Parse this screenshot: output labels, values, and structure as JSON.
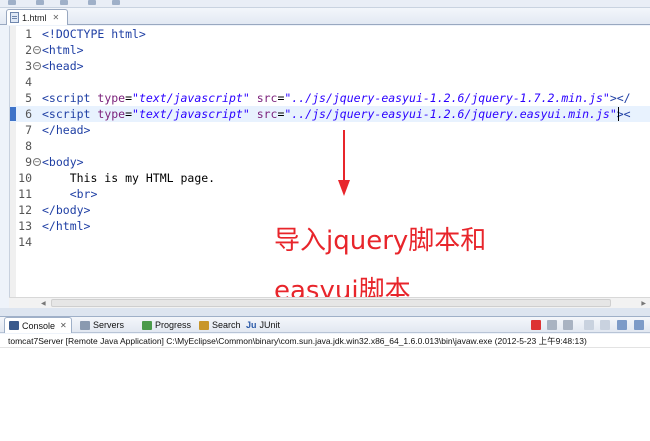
{
  "editor_tab": {
    "label": "1.html",
    "close": "✕"
  },
  "lines": [
    {
      "num": "1",
      "fold": false,
      "tokens": [
        {
          "t": "<!DOCTYPE html>",
          "c": "tag"
        }
      ]
    },
    {
      "num": "2",
      "fold": true,
      "tokens": [
        {
          "t": "<html>",
          "c": "tag"
        }
      ]
    },
    {
      "num": "3",
      "fold": true,
      "tokens": [
        {
          "t": "<head>",
          "c": "tag"
        }
      ]
    },
    {
      "num": "4",
      "fold": false,
      "tokens": []
    },
    {
      "num": "5",
      "fold": false,
      "tokens": [
        {
          "t": "<script",
          "c": "tag"
        },
        {
          "t": " ",
          "c": "txt"
        },
        {
          "t": "type",
          "c": "attr"
        },
        {
          "t": "=",
          "c": "txt"
        },
        {
          "t": "\"text/javascript\"",
          "c": "str"
        },
        {
          "t": " ",
          "c": "txt"
        },
        {
          "t": "src",
          "c": "attr"
        },
        {
          "t": "=",
          "c": "txt"
        },
        {
          "t": "\"../js/jquery-easyui-1.2.6/jquery-1.7.2.min.js\"",
          "c": "str"
        },
        {
          "t": "></",
          "c": "tag"
        }
      ]
    },
    {
      "num": "6",
      "fold": false,
      "highlight": true,
      "tokens": [
        {
          "t": "<script",
          "c": "tag"
        },
        {
          "t": " ",
          "c": "txt"
        },
        {
          "t": "type",
          "c": "attr"
        },
        {
          "t": "=",
          "c": "txt"
        },
        {
          "t": "\"text/javascript\"",
          "c": "str"
        },
        {
          "t": " ",
          "c": "txt"
        },
        {
          "t": "src",
          "c": "attr"
        },
        {
          "t": "=",
          "c": "txt"
        },
        {
          "t": "\"../js/jquery-easyui-1.2.6/jquery.easyui.min.js\"",
          "c": "str"
        },
        {
          "t": "><",
          "c": "tag"
        }
      ]
    },
    {
      "num": "7",
      "fold": false,
      "tokens": [
        {
          "t": "</head>",
          "c": "tag"
        }
      ]
    },
    {
      "num": "8",
      "fold": false,
      "tokens": []
    },
    {
      "num": "9",
      "fold": true,
      "tokens": [
        {
          "t": "<body>",
          "c": "tag"
        }
      ]
    },
    {
      "num": "10",
      "fold": false,
      "tokens": [
        {
          "t": "    This is my HTML page.",
          "c": "txt"
        }
      ]
    },
    {
      "num": "11",
      "fold": false,
      "tokens": [
        {
          "t": "    <br>",
          "c": "tag"
        }
      ]
    },
    {
      "num": "12",
      "fold": false,
      "tokens": [
        {
          "t": "</body>",
          "c": "tag"
        }
      ]
    },
    {
      "num": "13",
      "fold": false,
      "tokens": [
        {
          "t": "</html>",
          "c": "tag"
        }
      ]
    },
    {
      "num": "14",
      "fold": false,
      "tokens": []
    }
  ],
  "annotation": {
    "line1": "导入jquery脚本和",
    "line2": "easyui脚本",
    "color": "#e8252b"
  },
  "panel_tabs": [
    {
      "label": "Console",
      "icon": "console-icon",
      "active": true,
      "close": "✕"
    },
    {
      "label": "Servers",
      "icon": "servers-icon"
    },
    {
      "label": "Progress",
      "icon": "progress-icon"
    },
    {
      "label": "Search",
      "icon": "search-icon"
    },
    {
      "label": "JUnit",
      "icon": "junit-icon",
      "prefix": "Ju"
    }
  ],
  "console": {
    "description": "tomcat7Server [Remote Java Application] C:\\MyEclipse\\Common\\binary\\com.sun.java.jdk.win32.x86_64_1.6.0.013\\bin\\javaw.exe (2012-5-23 上午9:48:13)"
  },
  "colors": {
    "tag": "#1f3fa4",
    "attr": "#7a1f7a",
    "string": "#2a00ff",
    "highlight": "#e8f2fe"
  }
}
